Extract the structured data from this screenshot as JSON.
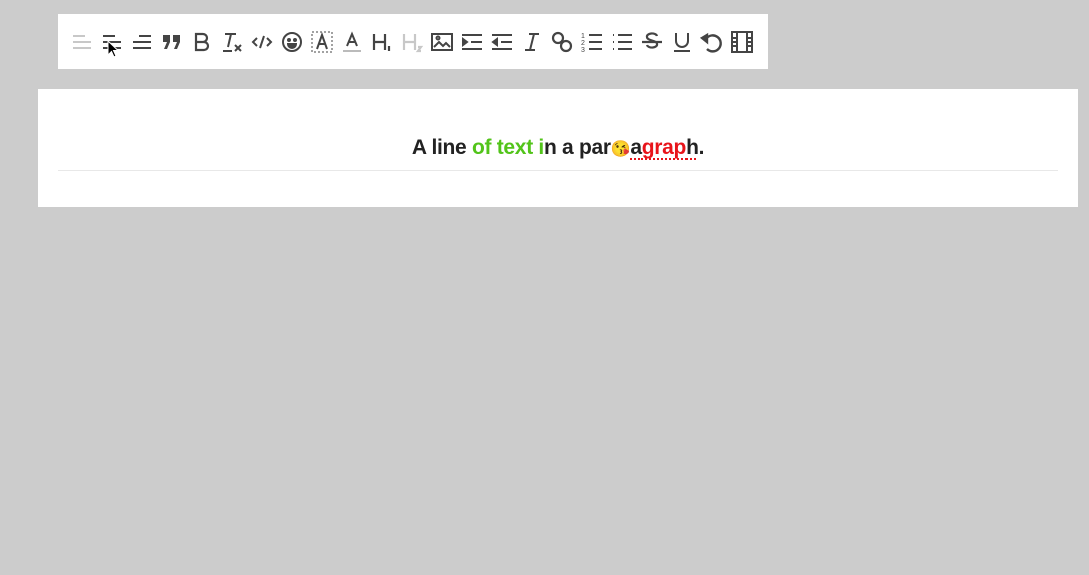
{
  "toolbar": {
    "items": [
      {
        "name": "align-left-icon",
        "disabled": true
      },
      {
        "name": "align-center-icon",
        "disabled": false
      },
      {
        "name": "align-right-icon",
        "disabled": false
      },
      {
        "name": "blockquote-icon",
        "disabled": false
      },
      {
        "name": "bold-icon",
        "disabled": false
      },
      {
        "name": "clear-format-icon",
        "disabled": false
      },
      {
        "name": "code-icon",
        "disabled": false
      },
      {
        "name": "emoji-icon",
        "disabled": false
      },
      {
        "name": "background-color-icon",
        "disabled": false
      },
      {
        "name": "font-color-icon",
        "disabled": false
      },
      {
        "name": "heading1-icon",
        "disabled": false
      },
      {
        "name": "heading2-icon",
        "disabled": true
      },
      {
        "name": "image-icon",
        "disabled": false
      },
      {
        "name": "indent-icon",
        "disabled": false
      },
      {
        "name": "outdent-icon",
        "disabled": false
      },
      {
        "name": "italic-icon",
        "disabled": false
      },
      {
        "name": "link-icon",
        "disabled": false
      },
      {
        "name": "ordered-list-icon",
        "disabled": false
      },
      {
        "name": "bullet-list-icon",
        "disabled": false
      },
      {
        "name": "strikethrough-icon",
        "disabled": false
      },
      {
        "name": "underline-icon",
        "disabled": false
      },
      {
        "name": "undo-icon",
        "disabled": false
      },
      {
        "name": "video-icon",
        "disabled": false
      }
    ]
  },
  "editor": {
    "segments": [
      {
        "text": "A line ",
        "color": "#222222"
      },
      {
        "text": "of text i",
        "color": "#52c41a"
      },
      {
        "text": "n a par",
        "color": "#222222"
      },
      {
        "text": "😘",
        "color": ""
      },
      {
        "text": "a",
        "color": "#222222"
      },
      {
        "text": "grap",
        "color": "#e8141a"
      },
      {
        "text": "h",
        "color": "#222222"
      },
      {
        "text": ".",
        "color": "#222222"
      }
    ]
  }
}
